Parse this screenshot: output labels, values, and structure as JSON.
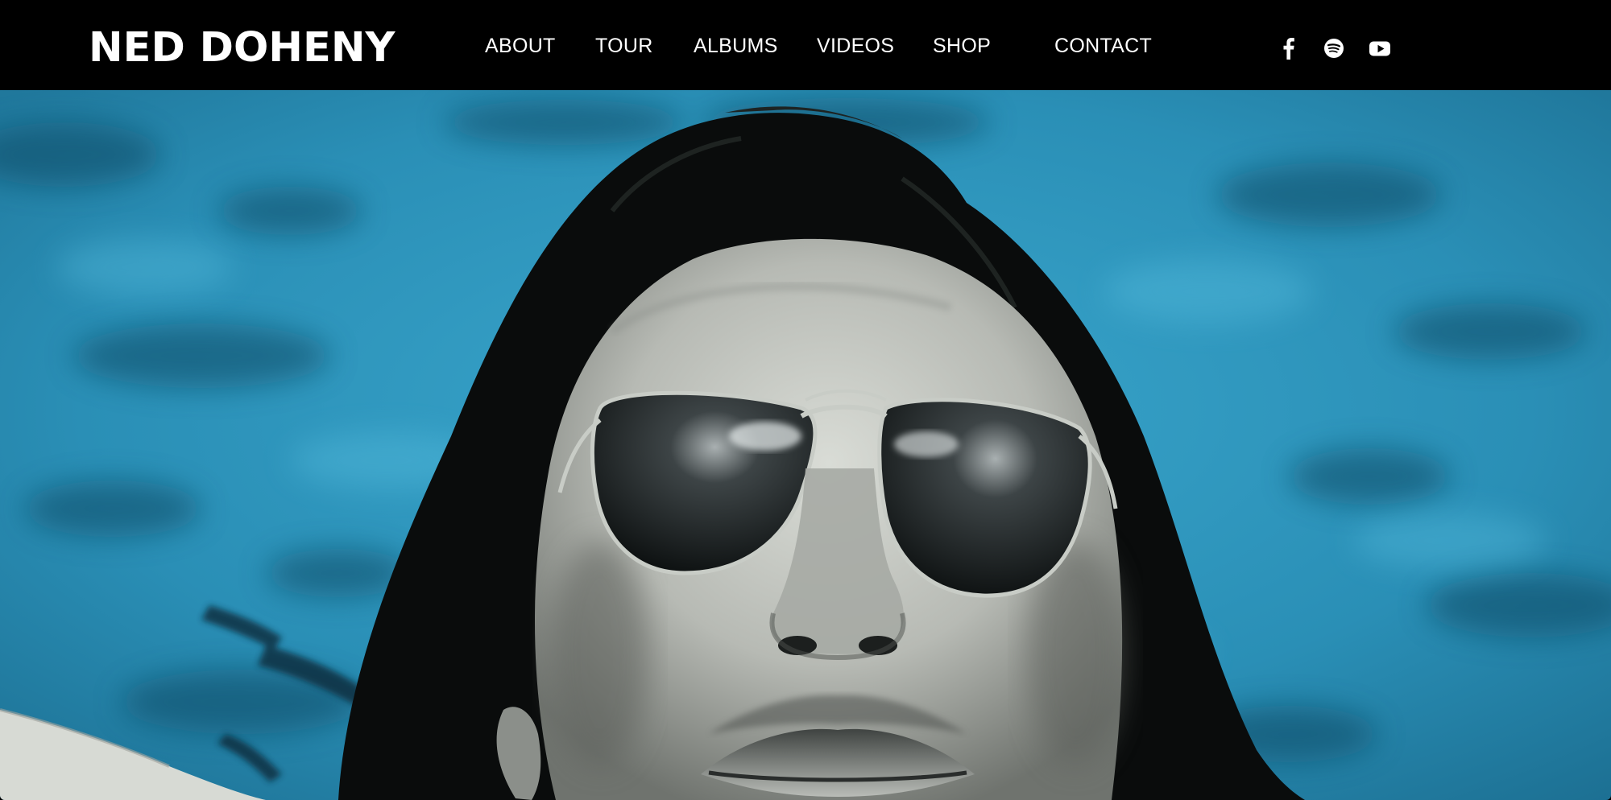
{
  "site": {
    "logo": "NED DOHENY"
  },
  "nav": {
    "items": [
      {
        "label": "ABOUT"
      },
      {
        "label": "TOUR"
      },
      {
        "label": "ALBUMS"
      },
      {
        "label": "VIDEOS"
      },
      {
        "label": "SHOP"
      },
      {
        "label": "CONTACT"
      }
    ]
  },
  "social": [
    {
      "icon": "facebook-icon"
    },
    {
      "icon": "spotify-icon"
    },
    {
      "icon": "youtube-icon"
    }
  ],
  "colors": {
    "header_bg": "#000000",
    "header_text": "#ffffff",
    "sky_blue": "#2b9cc2"
  }
}
